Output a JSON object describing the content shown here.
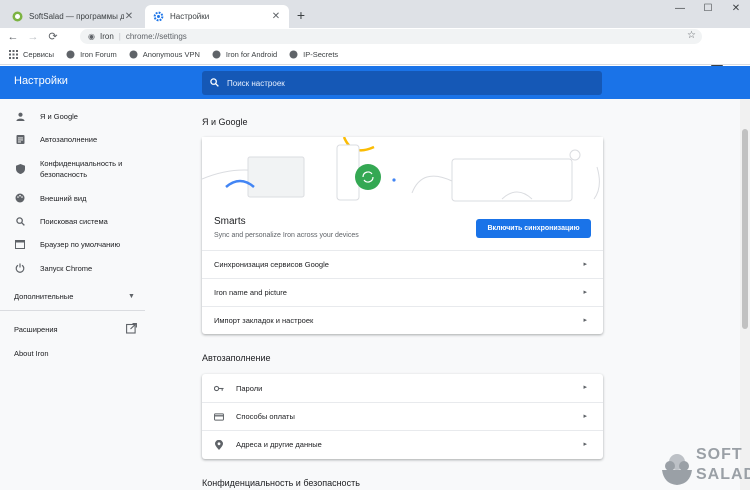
{
  "tabs": [
    {
      "title": "SoftSalad — программы для Wi",
      "icon": "softsalad-favicon"
    },
    {
      "title": "Настройки",
      "icon": "gear-icon"
    }
  ],
  "window_controls": {
    "minimize": "—",
    "maximize": "☐",
    "close": "✕"
  },
  "toolbar": {
    "site_label": "Iron",
    "url": "chrome://settings"
  },
  "bookmarks": [
    {
      "label": "Сервисы",
      "icon": "apps-grid-icon"
    },
    {
      "label": "Iron Forum",
      "icon": "globe-icon"
    },
    {
      "label": "Anonymous VPN",
      "icon": "globe-icon"
    },
    {
      "label": "Iron for Android",
      "icon": "globe-icon"
    },
    {
      "label": "IP-Secrets",
      "icon": "globe-icon"
    }
  ],
  "header": {
    "title": "Настройки",
    "search_placeholder": "Поиск настроек"
  },
  "sidebar": {
    "items": [
      {
        "label": "Я и Google",
        "icon": "person-icon"
      },
      {
        "label": "Автозаполнение",
        "icon": "clipboard-icon"
      },
      {
        "label": "Конфиденциальность и безопасность",
        "icon": "shield-icon"
      },
      {
        "label": "Внешний вид",
        "icon": "palette-icon"
      },
      {
        "label": "Поисковая система",
        "icon": "search-icon"
      },
      {
        "label": "Браузер по умолчанию",
        "icon": "browser-icon"
      },
      {
        "label": "Запуск Chrome",
        "icon": "power-icon"
      }
    ],
    "advanced": "Дополнительные",
    "extensions": "Расширения",
    "about": "About Iron"
  },
  "main": {
    "section_you_google": "Я и Google",
    "smarts_title": "Smarts",
    "smarts_subtitle": "Sync and personalize Iron across your devices",
    "sync_button": "Включить синхронизацию",
    "you_rows": [
      "Синхронизация сервисов Google",
      "Iron name and picture",
      "Импорт закладок и настроек"
    ],
    "section_autofill": "Автозаполнение",
    "autofill_rows": [
      {
        "label": "Пароли",
        "icon": "key-icon"
      },
      {
        "label": "Способы оплаты",
        "icon": "credit-card-icon"
      },
      {
        "label": "Адреса и другие данные",
        "icon": "location-pin-icon"
      }
    ],
    "section_privacy": "Конфиденциальность и безопасность"
  },
  "watermark": {
    "line1": "SOFT",
    "line2": "SALAD"
  },
  "colors": {
    "accent": "#1a73e8",
    "header_search": "#1558b6",
    "sync_green": "#34a853"
  }
}
